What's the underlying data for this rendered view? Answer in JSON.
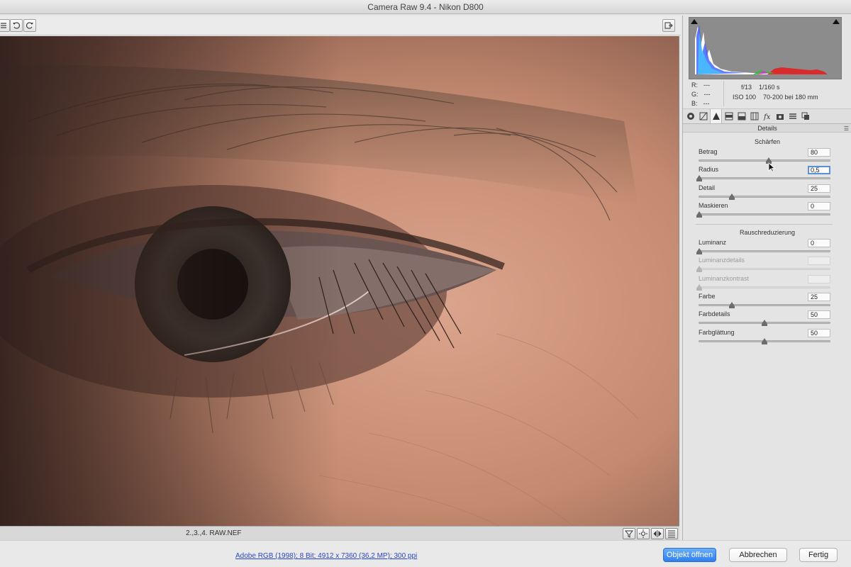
{
  "window": {
    "title": "Camera Raw 9.4 - Nikon D800"
  },
  "image": {
    "filename": "2.,3.,4. RAW.NEF",
    "alt": "Close-up of an eye"
  },
  "readout": {
    "r_label": "R:",
    "r_value": "---",
    "g_label": "G:",
    "g_value": "---",
    "b_label": "B:",
    "b_value": "---"
  },
  "camera_info": {
    "aperture": "f/13",
    "shutter": "1/160 s",
    "iso": "ISO 100",
    "lens": "70-200 bei 180 mm"
  },
  "panel_tabs": [
    {
      "icon": "aperture-icon"
    },
    {
      "icon": "tone-curve-icon"
    },
    {
      "icon": "detail-triangle-icon",
      "active": true
    },
    {
      "icon": "hsl-icon"
    },
    {
      "icon": "split-toning-icon"
    },
    {
      "icon": "lens-corrections-icon"
    },
    {
      "icon": "fx-icon"
    },
    {
      "icon": "camera-calibration-icon"
    },
    {
      "icon": "presets-icon"
    },
    {
      "icon": "snapshots-icon"
    }
  ],
  "details": {
    "title": "Details",
    "sharpening": {
      "title": "Schärfen",
      "sliders": [
        {
          "label": "Betrag",
          "value": "80",
          "min": 0,
          "max": 150,
          "focused": false,
          "disabled": false
        },
        {
          "label": "Radius",
          "value": "0,5",
          "min": 0.5,
          "max": 3.0,
          "focused": true,
          "disabled": false
        },
        {
          "label": "Detail",
          "value": "25",
          "min": 0,
          "max": 100,
          "focused": false,
          "disabled": false
        },
        {
          "label": "Maskieren",
          "value": "0",
          "min": 0,
          "max": 100,
          "focused": false,
          "disabled": false
        }
      ]
    },
    "noise": {
      "title": "Rauschreduzierung",
      "sliders": [
        {
          "label": "Luminanz",
          "value": "0",
          "min": 0,
          "max": 100,
          "focused": false,
          "disabled": false
        },
        {
          "label": "Luminanzdetails",
          "value": "",
          "min": 0,
          "max": 100,
          "focused": false,
          "disabled": true
        },
        {
          "label": "Luminanzkontrast",
          "value": "",
          "min": 0,
          "max": 100,
          "focused": false,
          "disabled": true
        },
        {
          "label": "Farbe",
          "value": "25",
          "min": 0,
          "max": 100,
          "focused": false,
          "disabled": false
        },
        {
          "label": "Farbdetails",
          "value": "50",
          "min": 0,
          "max": 100,
          "focused": false,
          "disabled": false
        },
        {
          "label": "Farbglättung",
          "value": "50",
          "min": 0,
          "max": 100,
          "focused": false,
          "disabled": false
        }
      ]
    }
  },
  "bottom": {
    "workflow_link": "Adobe RGB (1998); 8 Bit; 4912 x 7360 (36,2 MP); 300 ppi",
    "open_button": "Objekt öffnen",
    "cancel_button": "Abbrechen",
    "done_button": "Fertig"
  },
  "colors": {
    "primary_button": "#3a86f2",
    "focus_ring": "#5a8fdc",
    "link": "#2a47c7"
  }
}
